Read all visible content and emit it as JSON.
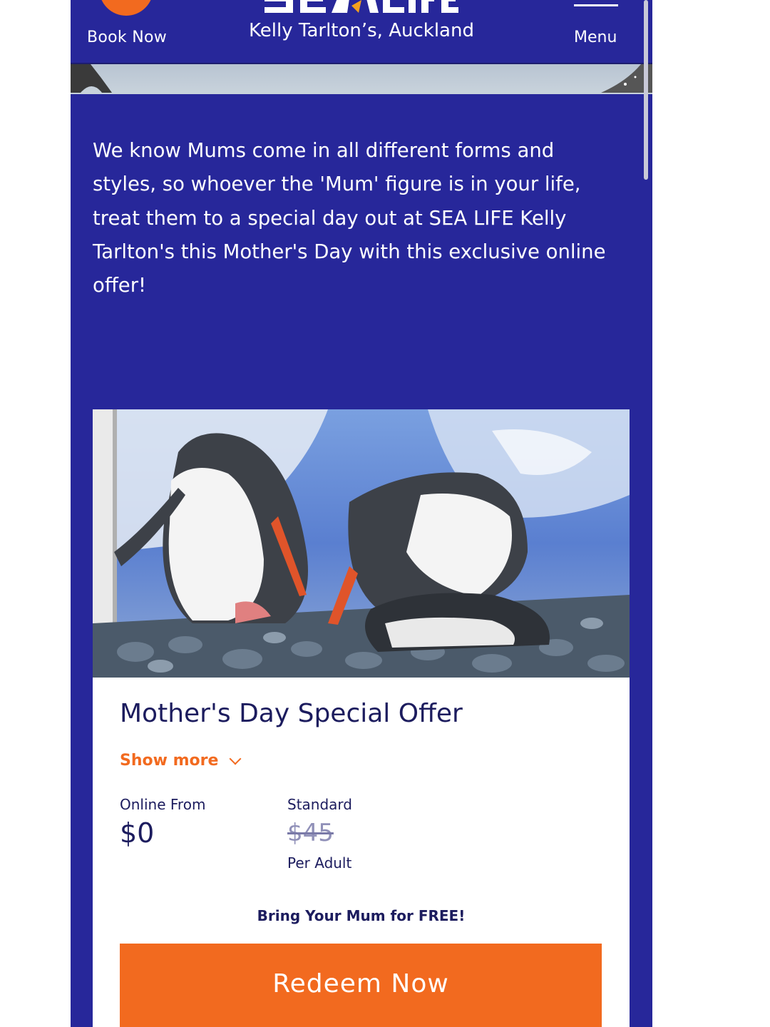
{
  "header": {
    "book_label": "Book Now",
    "location": "Kelly Tarlton’s, Auckland",
    "menu_label": "Menu",
    "brand_logo_text": "SEA LIFE"
  },
  "intro": {
    "text": "We know Mums come in all different forms and styles, so whoever the 'Mum' figure is in your life, treat them to a special day out at SEA LIFE Kelly Tarlton's this Mother's Day with this exclusive online offer!"
  },
  "offer": {
    "photo_description": "penguins-nesting-photo",
    "title": "Mother's Day Special Offer",
    "show_more_label": "Show more",
    "online_label": "Online From",
    "online_price": "$0",
    "standard_label": "Standard",
    "standard_price": "$45",
    "per_adult_label": "Per Adult",
    "tagline": "Bring Your Mum for FREE!",
    "cta_label": "Redeem Now"
  },
  "colors": {
    "brand_blue": "#27279a",
    "accent_orange": "#f26a1f",
    "title_navy": "#1c1c5e"
  },
  "icons": [
    "location-pin-icon",
    "hamburger-menu-icon",
    "chevron-down-icon"
  ]
}
